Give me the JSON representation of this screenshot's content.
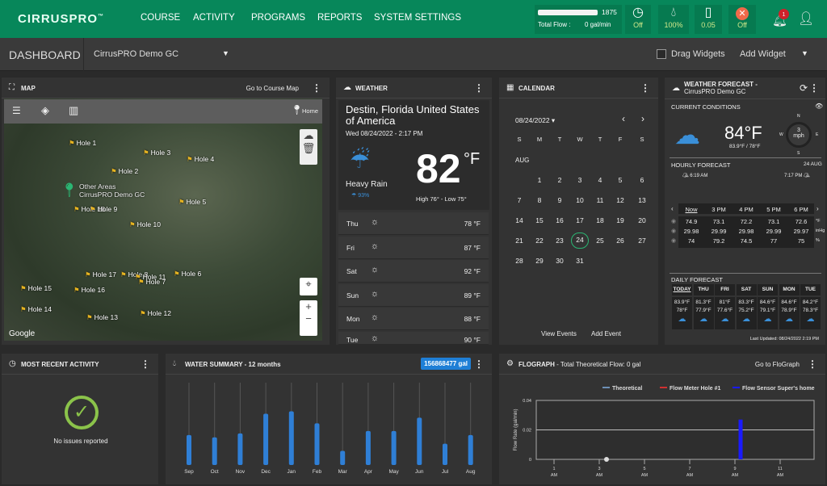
{
  "header": {
    "logo": "CIRRUSPRO",
    "tm": "™",
    "nav": [
      "COURSE",
      "ACTIVITY",
      "PROGRAMS",
      "REPORTS",
      "SYSTEM SETTINGS"
    ],
    "flow_bar_value": "1875",
    "total_flow_label": "Total Flow :",
    "total_flow_value": "0 gal/min",
    "status": [
      {
        "icon": "clock-icon",
        "value": "Off"
      },
      {
        "icon": "water-drop-icon",
        "value": "100%"
      },
      {
        "icon": "gauge-icon",
        "value": "0.05"
      },
      {
        "icon": "cancel-icon",
        "value": "Off"
      }
    ],
    "notification_count": "1",
    "colors": {
      "brand": "#07875a",
      "accent": "#cfe88a"
    }
  },
  "subheader": {
    "title": "DASHBOARD",
    "course": "CirrusPRO Demo GC",
    "drag_widgets": "Drag Widgets",
    "add_widget": "Add Widget"
  },
  "map": {
    "title": "MAP",
    "link": "Go to Course Map",
    "home": "Home",
    "attribution": "Google",
    "holes": [
      "Hole 1",
      "Hole 3",
      "Hole 4",
      "Hole 2",
      "Hole 5",
      "Hole 18",
      "Hole 9",
      "Hole 10",
      "Hole 17",
      "Hole 8",
      "Hole 11",
      "Hole 7",
      "Hole 6",
      "Hole 16",
      "Hole 15",
      "Hole 14",
      "Hole 13",
      "Hole 12"
    ],
    "other_areas": "Other Areas",
    "other_areas_sub": "CirrusPRO Demo GC"
  },
  "weather": {
    "title": "WEATHER",
    "location": "Destin, Florida United States of America",
    "datetime": "Wed 08/24/2022 - 2:17 PM",
    "condition": "Heavy Rain",
    "precip": "☂ 93%",
    "temp": "82",
    "unit": "°F",
    "hilo": "High 76° - Low 75°",
    "days": [
      {
        "day": "Thu",
        "temp": "78 °F"
      },
      {
        "day": "Fri",
        "temp": "87 °F"
      },
      {
        "day": "Sat",
        "temp": "92 °F"
      },
      {
        "day": "Sun",
        "temp": "89 °F"
      },
      {
        "day": "Mon",
        "temp": "88 °F"
      },
      {
        "day": "Tue",
        "temp": "90 °F"
      }
    ]
  },
  "calendar": {
    "title": "CALENDAR",
    "selected": "08/24/2022",
    "weekdays": [
      "S",
      "M",
      "T",
      "W",
      "T",
      "F",
      "S"
    ],
    "month": "AUG",
    "today": "24",
    "view_events": "View Events",
    "add_event": "Add Event"
  },
  "forecast": {
    "title": "WEATHER FORECAST -",
    "subtitle": "CirrusPRO Demo GC",
    "current_label": "CURRENT CONDITIONS",
    "temp": "84°F",
    "hilo": "83.9°F / 78°F",
    "wind": "3",
    "wind_unit": "mph",
    "compass": [
      "N",
      "E",
      "S",
      "W"
    ],
    "hourly_label": "HOURLY FORECAST",
    "hourly_date": "24 AUG",
    "sunrise": "6:19 AM",
    "sunset": "7:17 PM",
    "hours": [
      "Now",
      "3 PM",
      "4 PM",
      "5 PM",
      "6 PM"
    ],
    "rows": [
      {
        "unit": "°F",
        "values": [
          "74.9",
          "73.1",
          "72.2",
          "73.1",
          "72.6"
        ]
      },
      {
        "unit": "inHg",
        "values": [
          "29.98",
          "29.99",
          "29.98",
          "29.99",
          "29.97"
        ]
      },
      {
        "unit": "%",
        "values": [
          "74",
          "79.2",
          "74.5",
          "77",
          "75"
        ]
      }
    ],
    "daily_label": "DAILY FORECAST",
    "days": [
      {
        "d": "TODAY",
        "hi": "83.9°F",
        "lo": "78°F"
      },
      {
        "d": "THU",
        "hi": "81.3°F",
        "lo": "77.9°F"
      },
      {
        "d": "FRI",
        "hi": "81°F",
        "lo": "77.6°F"
      },
      {
        "d": "SAT",
        "hi": "83.3°F",
        "lo": "75.2°F"
      },
      {
        "d": "SUN",
        "hi": "84.6°F",
        "lo": "79.1°F"
      },
      {
        "d": "MON",
        "hi": "84.6°F",
        "lo": "78.9°F"
      },
      {
        "d": "TUE",
        "hi": "84.2°F",
        "lo": "78.3°F"
      }
    ],
    "last_updated": "Last Updated: 08/24/2022 2:19 PM"
  },
  "activity": {
    "title": "MOST RECENT ACTIVITY",
    "message": "No issues reported"
  },
  "water": {
    "title": "WATER SUMMARY",
    "subtitle": " - 12 months",
    "total": "156868477 gal"
  },
  "flograph": {
    "title": "FLOGRAPH",
    "subtitle": " - Total Theoretical Flow: 0 gal",
    "link": "Go to FloGraph"
  },
  "chart_data": [
    {
      "type": "bar",
      "title": "WATER SUMMARY - 12 months",
      "categories": [
        "Sep",
        "Oct",
        "Nov",
        "Dec",
        "Jan",
        "Feb",
        "Mar",
        "Apr",
        "May",
        "Jun",
        "Jul",
        "Aug"
      ],
      "values": [
        11300000,
        10400000,
        11900000,
        19300000,
        20200000,
        15700000,
        5300000,
        12800000,
        12800000,
        17800000,
        8000000,
        11300000
      ],
      "ylim": [
        0,
        31000000
      ],
      "color": "#2f7fd6",
      "grid": "vertical"
    },
    {
      "type": "bar",
      "title": "FLOGRAPH",
      "ylabel": "Flow Rate (gal/min)",
      "ylim": [
        0,
        0.04
      ],
      "yticks": [
        "0",
        "0.02",
        "0.04"
      ],
      "xticks": [
        {
          "h": "1",
          "p": "AM"
        },
        {
          "h": "3",
          "p": "AM"
        },
        {
          "h": "5",
          "p": "AM"
        },
        {
          "h": "7",
          "p": "AM"
        },
        {
          "h": "9",
          "p": "AM"
        },
        {
          "h": "11",
          "p": "AM"
        }
      ],
      "series": [
        {
          "name": "Theoretical",
          "color": "#6d8fb5",
          "values": []
        },
        {
          "name": "Flow Meter Hole #1",
          "color": "#d03030",
          "values": []
        },
        {
          "name": "Flow Sensor Super's home",
          "color": "#1a1aff",
          "points": [
            {
              "x": "9:15 AM",
              "y": 0.027
            }
          ]
        }
      ],
      "legend": "top-right"
    }
  ]
}
